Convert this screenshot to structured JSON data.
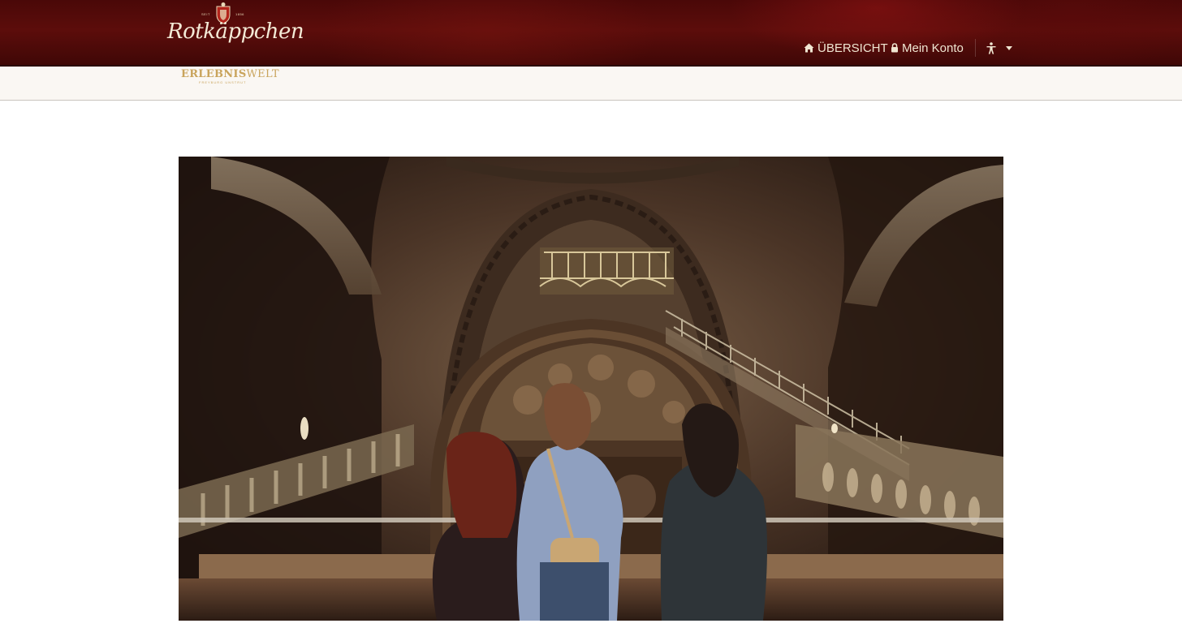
{
  "header": {
    "brand": {
      "name": "Rotkäppchen",
      "crest_year_left": "SEIT",
      "crest_year_right": "1856"
    },
    "nav": {
      "overview_label": "ÜBERSICHT",
      "overview_icon": "home-icon",
      "account_label": "Mein Konto",
      "account_icon": "lock-icon",
      "accessibility_icon": "accessibility-icon"
    }
  },
  "subheader": {
    "logo_bold": "ERLEBNIS",
    "logo_light": "WELT",
    "logo_small": "FREYBURG UNSTRUT"
  },
  "hero": {
    "image": "wine-cellar-photo"
  },
  "colors": {
    "header_bg": "#5c0d0b",
    "nav_text": "#f0e6d2",
    "subbar_bg": "#faf7f3",
    "logo_gold": "#c9a45c"
  }
}
